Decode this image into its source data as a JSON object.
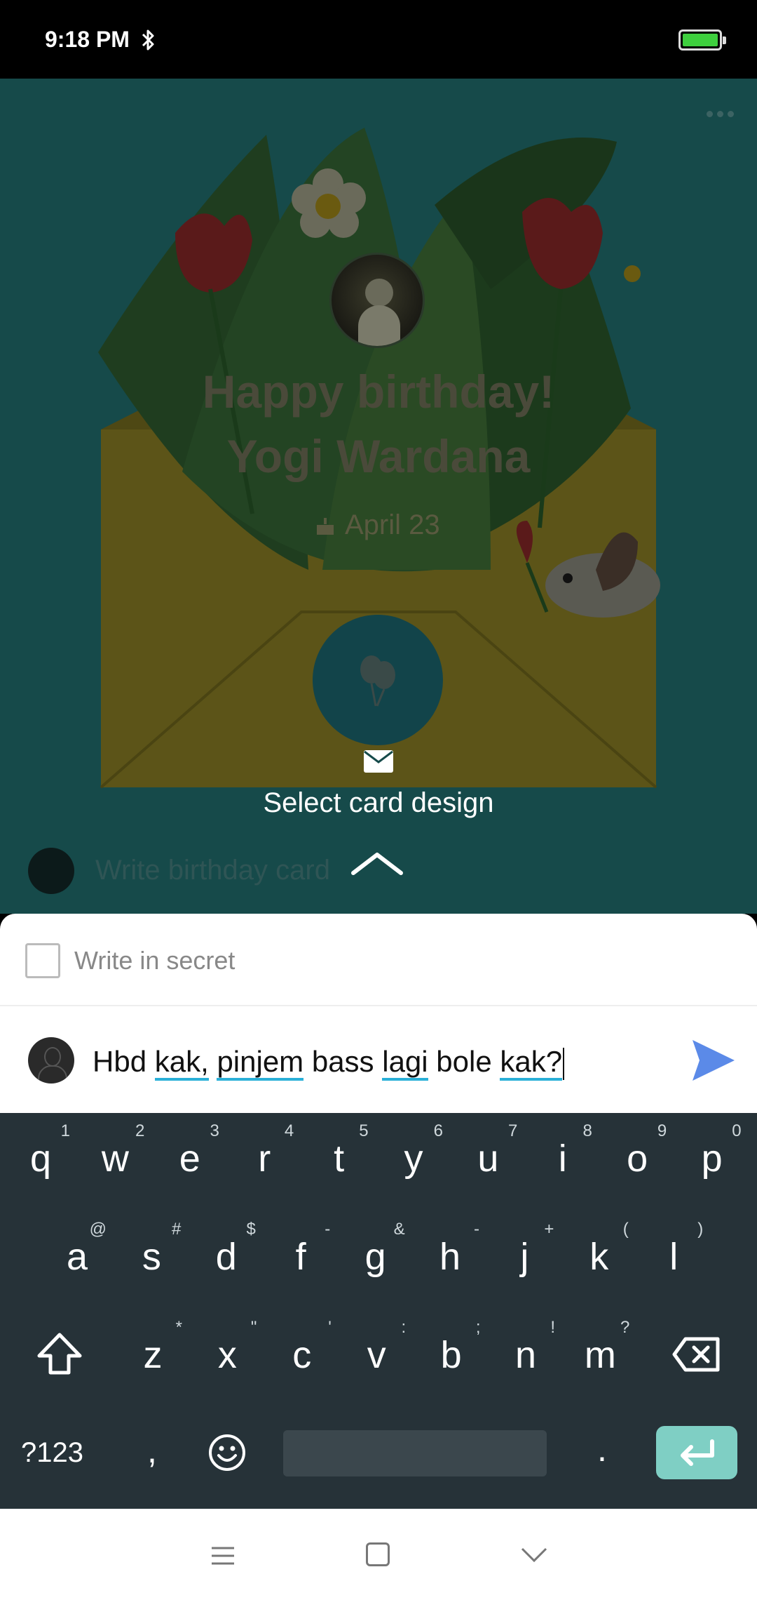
{
  "status_bar": {
    "time": "9:18 PM",
    "bluetooth_icon": "bluetooth-icon",
    "battery_icon": "battery-full-icon"
  },
  "card": {
    "title_line1": "Happy birthday!",
    "title_line2": "Yogi Wardana",
    "date": "April 23",
    "select_design_label": "Select card design",
    "write_card_placeholder": "Write birthday card"
  },
  "sheet": {
    "secret_label": "Write in secret",
    "secret_checked": false,
    "message_words": [
      "Hbd",
      "kak,",
      "pinjem",
      "bass",
      "lagi",
      "bole",
      "kak?"
    ]
  },
  "keyboard": {
    "row1": [
      {
        "k": "q",
        "h": "1"
      },
      {
        "k": "w",
        "h": "2"
      },
      {
        "k": "e",
        "h": "3"
      },
      {
        "k": "r",
        "h": "4"
      },
      {
        "k": "t",
        "h": "5"
      },
      {
        "k": "y",
        "h": "6"
      },
      {
        "k": "u",
        "h": "7"
      },
      {
        "k": "i",
        "h": "8"
      },
      {
        "k": "o",
        "h": "9"
      },
      {
        "k": "p",
        "h": "0"
      }
    ],
    "row2": [
      {
        "k": "a",
        "h": "@"
      },
      {
        "k": "s",
        "h": "#"
      },
      {
        "k": "d",
        "h": "$"
      },
      {
        "k": "f",
        "h": "-"
      },
      {
        "k": "g",
        "h": "&"
      },
      {
        "k": "h",
        "h": "-"
      },
      {
        "k": "j",
        "h": "+"
      },
      {
        "k": "k",
        "h": "("
      },
      {
        "k": "l",
        "h": ")"
      }
    ],
    "row3": [
      {
        "k": "z",
        "h": "*"
      },
      {
        "k": "x",
        "h": "\""
      },
      {
        "k": "c",
        "h": "'"
      },
      {
        "k": "v",
        "h": ":"
      },
      {
        "k": "b",
        "h": ";"
      },
      {
        "k": "n",
        "h": "!"
      },
      {
        "k": "m",
        "h": "?"
      }
    ],
    "symbols_label": "?123",
    "comma": ",",
    "period": "."
  },
  "colors": {
    "card_bg": "#164a4a",
    "keyboard_bg": "#263238",
    "enter_key": "#7fcfc4",
    "send_icon": "#5b8ae8",
    "spell_underline": "#2ab0d8"
  }
}
